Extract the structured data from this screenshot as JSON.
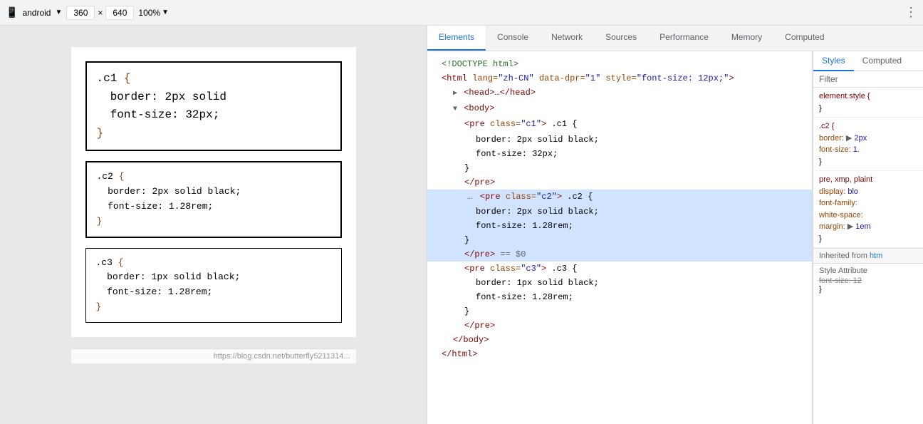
{
  "topbar": {
    "device": "android",
    "width": "360",
    "height": "640",
    "zoom": "100%",
    "dots": "⋮"
  },
  "devtools_tabs": [
    {
      "label": "Elements",
      "active": true
    },
    {
      "label": "Console",
      "active": false
    },
    {
      "label": "Network",
      "active": false
    },
    {
      "label": "Sources",
      "active": false
    },
    {
      "label": "Performance",
      "active": false
    },
    {
      "label": "Memory",
      "active": false
    },
    {
      "label": "Computed",
      "active": false
    }
  ],
  "styles_tabs": [
    {
      "label": "Styles",
      "active": true
    },
    {
      "label": "Computed",
      "active": false
    }
  ],
  "filter_label": "Filter",
  "dom": {
    "doctype": "<!DOCTYPE html>",
    "html_open": "<html lang=\"zh-CN\" data-dpr=\"1\" style=\"font-size: 12px;\">",
    "head": "▶ <head>…</head>",
    "body_open": "▼ <body>",
    "pre_c1_open": "<pre class=\"c1\">  .c1 {",
    "pre_c1_border": "  border: 2px solid black;",
    "pre_c1_font": "  font-size: 32px;",
    "pre_c1_close_brace": "}",
    "pre_c1_end": "</pre>",
    "pre_c2_open": "<pre class=\"c2\">  .c2 {",
    "pre_c2_border": "  border: 2px solid black;",
    "pre_c2_font": "  font-size: 1.28rem;",
    "pre_c2_close_brace": "}",
    "pre_c2_end": "</pre>  == $0",
    "pre_c3_open": "<pre class=\"c3\">  .c3 {",
    "pre_c3_border": "  border: 1px solid black;",
    "pre_c3_font": "  font-size: 1.28rem;",
    "pre_c3_close_brace": "}",
    "pre_c3_end": "</pre>",
    "body_close": "</body>",
    "html_close": "</html>"
  },
  "styles": {
    "element_style_open": "element.style {",
    "element_style_close": "}",
    "c2_selector": ".c2 {",
    "c2_border": "border: ▶ 2px",
    "c2_font": "font-size: 1.",
    "c2_close": "}",
    "pre_selector": "pre, xmp, plaint",
    "pre_display": "display: blo",
    "pre_font_family": "font-family:",
    "pre_white_space": "white-space:",
    "pre_margin": "margin: ▶ 1em",
    "pre_close": "}",
    "inherited_label": "Inherited from",
    "inherited_link": "htm",
    "style_attribute_label": "Style Attribute",
    "font_size_strikethrough": "font-size: 12",
    "style_attr_close": "}"
  },
  "preview": {
    "box1": {
      "selector": ".c1 {",
      "prop1": "  border: 2px solid",
      "prop2": "  font-size: 32px;",
      "close": "}"
    },
    "box2": {
      "selector": ".c2 {",
      "prop1": "  border: 2px solid black;",
      "prop2": "  font-size: 1.28rem;",
      "close": "}"
    },
    "box3": {
      "selector": ".c3 {",
      "prop1": "  border: 1px solid black;",
      "prop2": "  font-size: 1.28rem;",
      "close": "}"
    }
  },
  "url": "https://blog.csdn.net/butterfly5211314..."
}
